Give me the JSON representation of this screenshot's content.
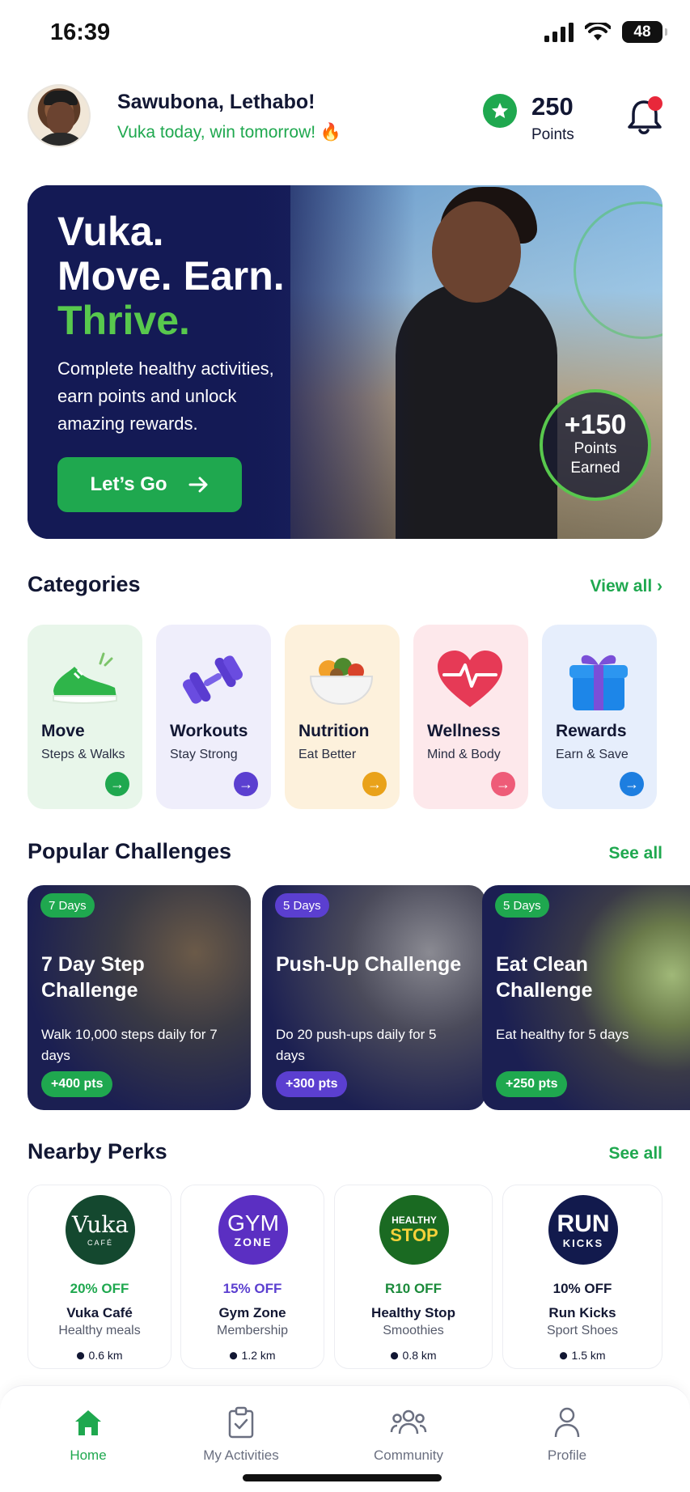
{
  "status_bar": {
    "time": "16:39",
    "battery": "48"
  },
  "header": {
    "greeting": "Sawubona, Lethabo!",
    "tagline": "Vuka today, win tomorrow! 🔥",
    "points_value": "250",
    "points_label": "Points"
  },
  "hero": {
    "line1": "Vuka.",
    "line2": "Move. Earn.",
    "line3": "Thrive.",
    "description": "Complete healthy activities, earn points and unlock amazing rewards.",
    "cta_label": "Let’s Go",
    "earned_value": "+150",
    "earned_label1": "Points",
    "earned_label2": "Earned"
  },
  "categories": {
    "title": "Categories",
    "link": "View all",
    "items": [
      {
        "name": "Move",
        "sub": "Steps & Walks",
        "icon": "sneaker-icon",
        "bg": "#e8f6ea",
        "accent": "#1fa84f"
      },
      {
        "name": "Workouts",
        "sub": "Stay Strong",
        "icon": "dumbbell-icon",
        "bg": "#efeefb",
        "accent": "#5b3fd0"
      },
      {
        "name": "Nutrition",
        "sub": "Eat Better",
        "icon": "food-bowl-icon",
        "bg": "#fdf1dc",
        "accent": "#e9a21a"
      },
      {
        "name": "Wellness",
        "sub": "Mind & Body",
        "icon": "heart-pulse-icon",
        "bg": "#fde8eb",
        "accent": "#ee5c78"
      },
      {
        "name": "Rewards",
        "sub": "Earn & Save",
        "icon": "gift-icon",
        "bg": "#e6eefc",
        "accent": "#1d7ee0"
      }
    ]
  },
  "challenges": {
    "title": "Popular Challenges",
    "link": "See all",
    "items": [
      {
        "days": "7 Days",
        "title": "7 Day Step Challenge",
        "desc": "Walk 10,000 steps daily for 7 days",
        "pts": "+400 pts",
        "accent": "#1fa84f"
      },
      {
        "days": "5 Days",
        "title": "Push-Up Challenge",
        "desc": "Do 20 push-ups daily for 5 days",
        "pts": "+300 pts",
        "accent": "#5b3fd0"
      },
      {
        "days": "5 Days",
        "title": "Eat Clean Challenge",
        "desc": "Eat healthy for 5 days",
        "pts": "+250 pts",
        "accent": "#1fa84f"
      }
    ]
  },
  "perks": {
    "title": "Nearby Perks",
    "link": "See all",
    "items": [
      {
        "logo_main": "Vuka",
        "logo_sub": "CAFÉ",
        "offer": "20% OFF",
        "name": "Vuka Café",
        "sub": "Healthy meals",
        "dist": "0.6 km",
        "logo_bg": "#14482f",
        "offer_color": "#1fa84f"
      },
      {
        "logo_main": "GYM",
        "logo_sub": "ZONE",
        "offer": "15% OFF",
        "name": "Gym Zone",
        "sub": "Membership",
        "dist": "1.2 km",
        "logo_bg": "#5b2fc2",
        "offer_color": "#5b3fd0"
      },
      {
        "logo_main": "HEALTHY",
        "logo_sub": "STOP",
        "offer": "R10 OFF",
        "name": "Healthy Stop",
        "sub": "Smoothies",
        "dist": "0.8 km",
        "logo_bg": "#1a6a22",
        "offer_color": "#1a8a3a"
      },
      {
        "logo_main": "RUN",
        "logo_sub": "KICKS",
        "offer": "10% OFF",
        "name": "Run Kicks",
        "sub": "Sport Shoes",
        "dist": "1.5 km",
        "logo_bg": "#121a4d",
        "offer_color": "#121733"
      }
    ]
  },
  "tabbar": {
    "items": [
      {
        "label": "Home",
        "icon": "home-icon",
        "active": true
      },
      {
        "label": "My Activities",
        "icon": "clipboard-icon",
        "active": false
      },
      {
        "label": "Community",
        "icon": "people-icon",
        "active": false
      },
      {
        "label": "Profile",
        "icon": "user-icon",
        "active": false
      }
    ]
  }
}
